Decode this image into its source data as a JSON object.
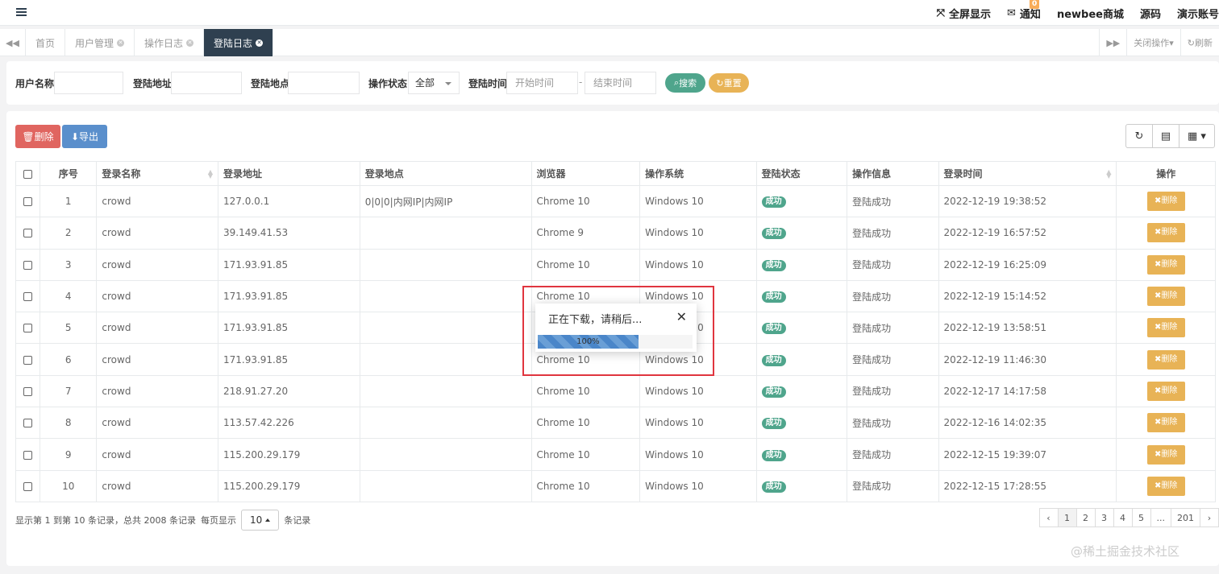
{
  "topbar": {
    "menu_icon": "hamburger-icon",
    "fullscreen": "全屏显示",
    "notice": "通知",
    "notice_count": "0",
    "brand": "newbee商城",
    "source": "源码",
    "demo_account": "演示账号"
  },
  "tabs": {
    "left_nav_icon": "backward-icon",
    "items": [
      {
        "label": "首页",
        "active": false,
        "closable": false
      },
      {
        "label": "用户管理",
        "active": false,
        "closable": true
      },
      {
        "label": "操作日志",
        "active": false,
        "closable": true
      },
      {
        "label": "登陆日志",
        "active": true,
        "closable": true
      }
    ],
    "close_ops": "关闭操作",
    "refresh": "刷新"
  },
  "search": {
    "username_label": "用户名称",
    "address_label": "登陆地址",
    "location_label": "登陆地点",
    "status_label": "操作状态",
    "status_value": "全部",
    "time_label": "登陆时间",
    "start_placeholder": "开始时间",
    "end_placeholder": "结束时间",
    "dash": "-",
    "search_btn": "搜索",
    "reset_btn": "重置"
  },
  "toolbar": {
    "delete_btn": "删除",
    "export_btn": "导出"
  },
  "table": {
    "columns": [
      "序号",
      "登录名称",
      "登录地址",
      "登录地点",
      "浏览器",
      "操作系统",
      "登陆状态",
      "操作信息",
      "登录时间",
      "操作"
    ],
    "row_action": "删除",
    "rows": [
      {
        "no": "1",
        "name": "crowd",
        "addr": "127.0.0.1",
        "loc": "0|0|0|内网IP|内网IP",
        "browser": "Chrome 10",
        "os": "Windows 10",
        "status": "成功",
        "msg": "登陆成功",
        "time": "2022-12-19 19:38:52"
      },
      {
        "no": "2",
        "name": "crowd",
        "addr": "39.149.41.53",
        "loc": "",
        "browser": "Chrome 9",
        "os": "Windows 10",
        "status": "成功",
        "msg": "登陆成功",
        "time": "2022-12-19 16:57:52"
      },
      {
        "no": "3",
        "name": "crowd",
        "addr": "171.93.91.85",
        "loc": "",
        "browser": "Chrome 10",
        "os": "Windows 10",
        "status": "成功",
        "msg": "登陆成功",
        "time": "2022-12-19 16:25:09"
      },
      {
        "no": "4",
        "name": "crowd",
        "addr": "171.93.91.85",
        "loc": "",
        "browser": "Chrome 10",
        "os": "Windows 10",
        "status": "成功",
        "msg": "登陆成功",
        "time": "2022-12-19 15:14:52"
      },
      {
        "no": "5",
        "name": "crowd",
        "addr": "171.93.91.85",
        "loc": "",
        "browser": "Chrome 10",
        "os": "Windows 10",
        "status": "成功",
        "msg": "登陆成功",
        "time": "2022-12-19 13:58:51"
      },
      {
        "no": "6",
        "name": "crowd",
        "addr": "171.93.91.85",
        "loc": "",
        "browser": "Chrome 10",
        "os": "Windows 10",
        "status": "成功",
        "msg": "登陆成功",
        "time": "2022-12-19 11:46:30"
      },
      {
        "no": "7",
        "name": "crowd",
        "addr": "218.91.27.20",
        "loc": "",
        "browser": "Chrome 10",
        "os": "Windows 10",
        "status": "成功",
        "msg": "登陆成功",
        "time": "2022-12-17 14:17:58"
      },
      {
        "no": "8",
        "name": "crowd",
        "addr": "113.57.42.226",
        "loc": "",
        "browser": "Chrome 10",
        "os": "Windows 10",
        "status": "成功",
        "msg": "登陆成功",
        "time": "2022-12-16 14:02:35"
      },
      {
        "no": "9",
        "name": "crowd",
        "addr": "115.200.29.179",
        "loc": "",
        "browser": "Chrome 10",
        "os": "Windows 10",
        "status": "成功",
        "msg": "登陆成功",
        "time": "2022-12-15 19:39:07"
      },
      {
        "no": "10",
        "name": "crowd",
        "addr": "115.200.29.179",
        "loc": "",
        "browser": "Chrome 10",
        "os": "Windows 10",
        "status": "成功",
        "msg": "登陆成功",
        "time": "2022-12-15 17:28:55"
      }
    ]
  },
  "pager": {
    "info_prefix": "显示第 1 到第 10 条记录，总共 2008 条记录",
    "per_page_label": "每页显示",
    "page_size": "10",
    "per_page_suffix": "条记录",
    "pages": [
      "‹",
      "1",
      "2",
      "3",
      "4",
      "5",
      "...",
      "201",
      "›"
    ],
    "active_page": "1"
  },
  "modal": {
    "title": "正在下载，请稍后...",
    "progress_text": "100%",
    "progress": 0.65
  },
  "watermark": "@稀土掘金技术社区",
  "colors": {
    "nav_dark": "#2f4050",
    "success": "#4fa58c",
    "warning": "#e8b356",
    "danger": "#e06560",
    "primary": "#5a8fcc",
    "highlight": "#e0353f"
  }
}
